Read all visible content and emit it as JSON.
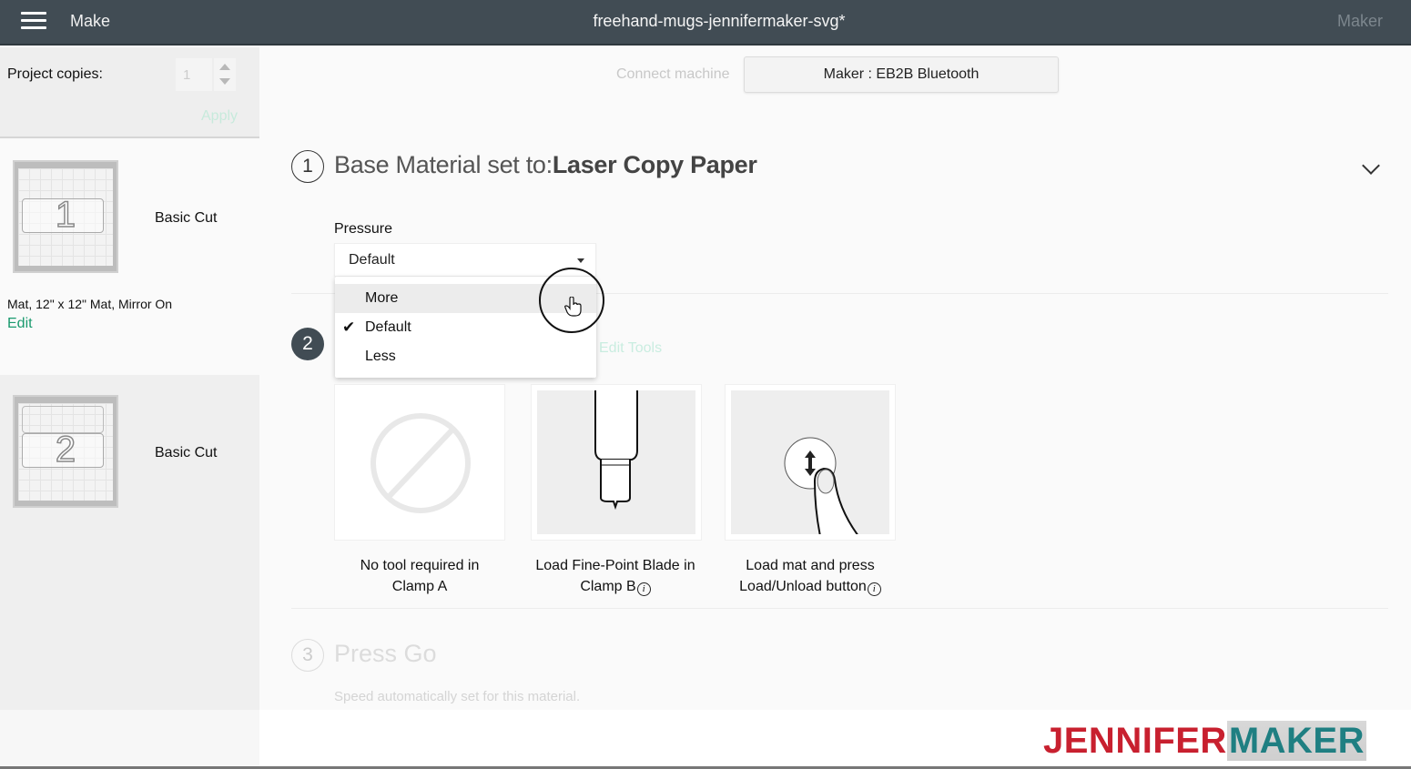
{
  "topbar": {
    "menu_icon": "hamburger-menu-icon",
    "section": "Make",
    "document_title": "freehand-mugs-jennifermaker-svg*",
    "machine": "Maker"
  },
  "sidebar": {
    "project_copies_label": "Project copies:",
    "project_copies_value": "1",
    "apply_label": "Apply",
    "mats": [
      {
        "number": "1",
        "name": "Basic Cut",
        "description": "Mat, 12\" x 12\" Mat, Mirror On",
        "edit_label": "Edit"
      },
      {
        "number": "2",
        "name": "Basic Cut"
      }
    ]
  },
  "main": {
    "connect_label": "Connect machine",
    "machine_button": "Maker : EB2B Bluetooth",
    "step1": {
      "number": "1",
      "title_prefix": "Base Material set to:",
      "material": "Laser Copy Paper",
      "pressure_label": "Pressure",
      "pressure_value": "Default",
      "pressure_options": [
        {
          "label": "More",
          "hovered": true,
          "checked": false
        },
        {
          "label": "Default",
          "hovered": false,
          "checked": true
        },
        {
          "label": "Less",
          "hovered": false,
          "checked": false
        }
      ]
    },
    "step2": {
      "number": "2",
      "edit_tools_label": "Edit Tools",
      "tools": [
        {
          "icon": "no-tool-icon",
          "caption_line1": "No tool required in",
          "caption_line2": "Clamp A",
          "info": false
        },
        {
          "icon": "fine-point-blade-icon",
          "caption_line1": "Load Fine-Point Blade in",
          "caption_line2": "Clamp B",
          "info": true
        },
        {
          "icon": "load-unload-button-icon",
          "caption_line1": "Load mat and press",
          "caption_line2": "Load/Unload button",
          "info": true
        }
      ]
    },
    "step3": {
      "number": "3",
      "title": "Press Go",
      "note": "Speed automatically set for this material."
    }
  },
  "watermark": {
    "part1": "JENNIFER",
    "part2": "MAKER",
    "color1": "#c8202f",
    "color2": "#1f7f82"
  },
  "info_glyph": "i"
}
